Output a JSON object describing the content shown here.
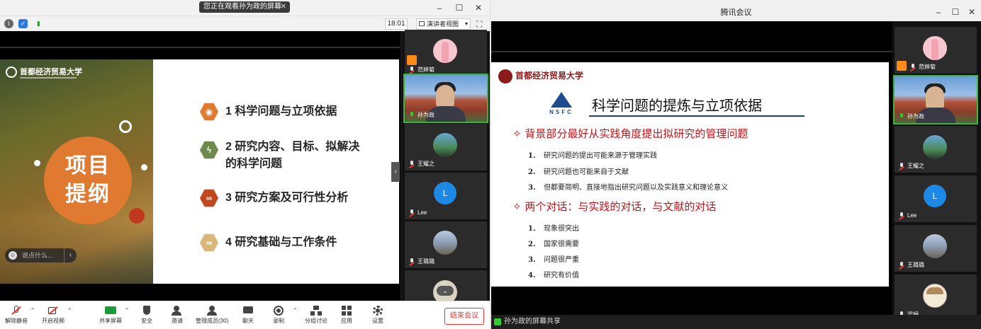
{
  "left_window": {
    "banner": "您正在观看孙为政的屏幕",
    "banner_close": "✕",
    "clock": "18:01",
    "view_mode": "演讲者视图",
    "slide": {
      "badge_text": "项目\n提纲",
      "badge_line1": "项目",
      "badge_line2": "提纲",
      "chat_placeholder": "说点什么...",
      "items": [
        {
          "text": "1 科学问题与立项依据",
          "color": "#e07a30",
          "icon": "signal-icon"
        },
        {
          "text": "2 研究内容、目标、拟解决",
          "text2": "的科学问题",
          "color": "#6b8a4c",
          "icon": "lightning-icon"
        },
        {
          "text": "3 研究方案及可行性分析",
          "color": "#c0471e",
          "icon": "link-icon"
        },
        {
          "text": "4 研究基础与工作条件",
          "color": "#d9b779",
          "icon": "link-icon"
        }
      ]
    },
    "participants": [
      {
        "name": "范婷菊",
        "kind": "photo"
      },
      {
        "name": "孙为政",
        "kind": "video"
      },
      {
        "name": "王耀之",
        "kind": "photo"
      },
      {
        "name": "Lee",
        "kind": "initial",
        "initial": "L"
      },
      {
        "name": "王璐璐",
        "kind": "photo"
      },
      {
        "name": "",
        "kind": "photo"
      }
    ],
    "toolbar": [
      {
        "label": "解除静音",
        "icon": "mic-muted-icon"
      },
      {
        "label": "开启视频",
        "icon": "camera-off-icon"
      },
      {
        "label": "共享屏幕",
        "icon": "share-screen-icon"
      },
      {
        "label": "安全",
        "icon": "shield-icon"
      },
      {
        "label": "邀请",
        "icon": "invite-icon"
      },
      {
        "label": "管理成员(30)",
        "icon": "members-icon"
      },
      {
        "label": "聊天",
        "icon": "chat-icon"
      },
      {
        "label": "录制",
        "icon": "record-icon"
      },
      {
        "label": "分组讨论",
        "icon": "breakout-icon"
      },
      {
        "label": "应用",
        "icon": "apps-icon"
      },
      {
        "label": "设置",
        "icon": "settings-icon"
      }
    ],
    "end_meeting": "结束会议"
  },
  "right_window": {
    "title": "腾讯会议",
    "slide": {
      "logo_text": "首都经济贸易大学",
      "nsfc": "NSFC",
      "title": "科学问题的提炼与立项依据",
      "section1": "✧ 背景部分最好从实践角度提出拟研究的管理问题",
      "section1_items": [
        {
          "num": "1.",
          "text": "研究问题的提出可能来源于管理实践"
        },
        {
          "num": "2.",
          "text": "研究问题也可能来自于文献"
        },
        {
          "num": "3.",
          "text": "但都要简明、直接地指出研究问题以及实践意义和理论意义"
        }
      ],
      "section2": "✧ 两个对话：与实践的对话，与文献的对话",
      "section2_items": [
        {
          "num": "1.",
          "text": "现象很突出"
        },
        {
          "num": "2.",
          "text": "国家很需要"
        },
        {
          "num": "3.",
          "text": "问题很严重"
        },
        {
          "num": "4.",
          "text": "研究有价值"
        }
      ]
    },
    "participants": [
      {
        "name": "范婷菊",
        "kind": "photo"
      },
      {
        "name": "孙为政",
        "kind": "video"
      },
      {
        "name": "王耀之",
        "kind": "photo"
      },
      {
        "name": "Lee",
        "kind": "initial",
        "initial": "L"
      },
      {
        "name": "王璐璐",
        "kind": "photo"
      },
      {
        "name": "梁娟",
        "kind": "cartoon"
      }
    ],
    "status": "孙为政的屏幕共享"
  }
}
